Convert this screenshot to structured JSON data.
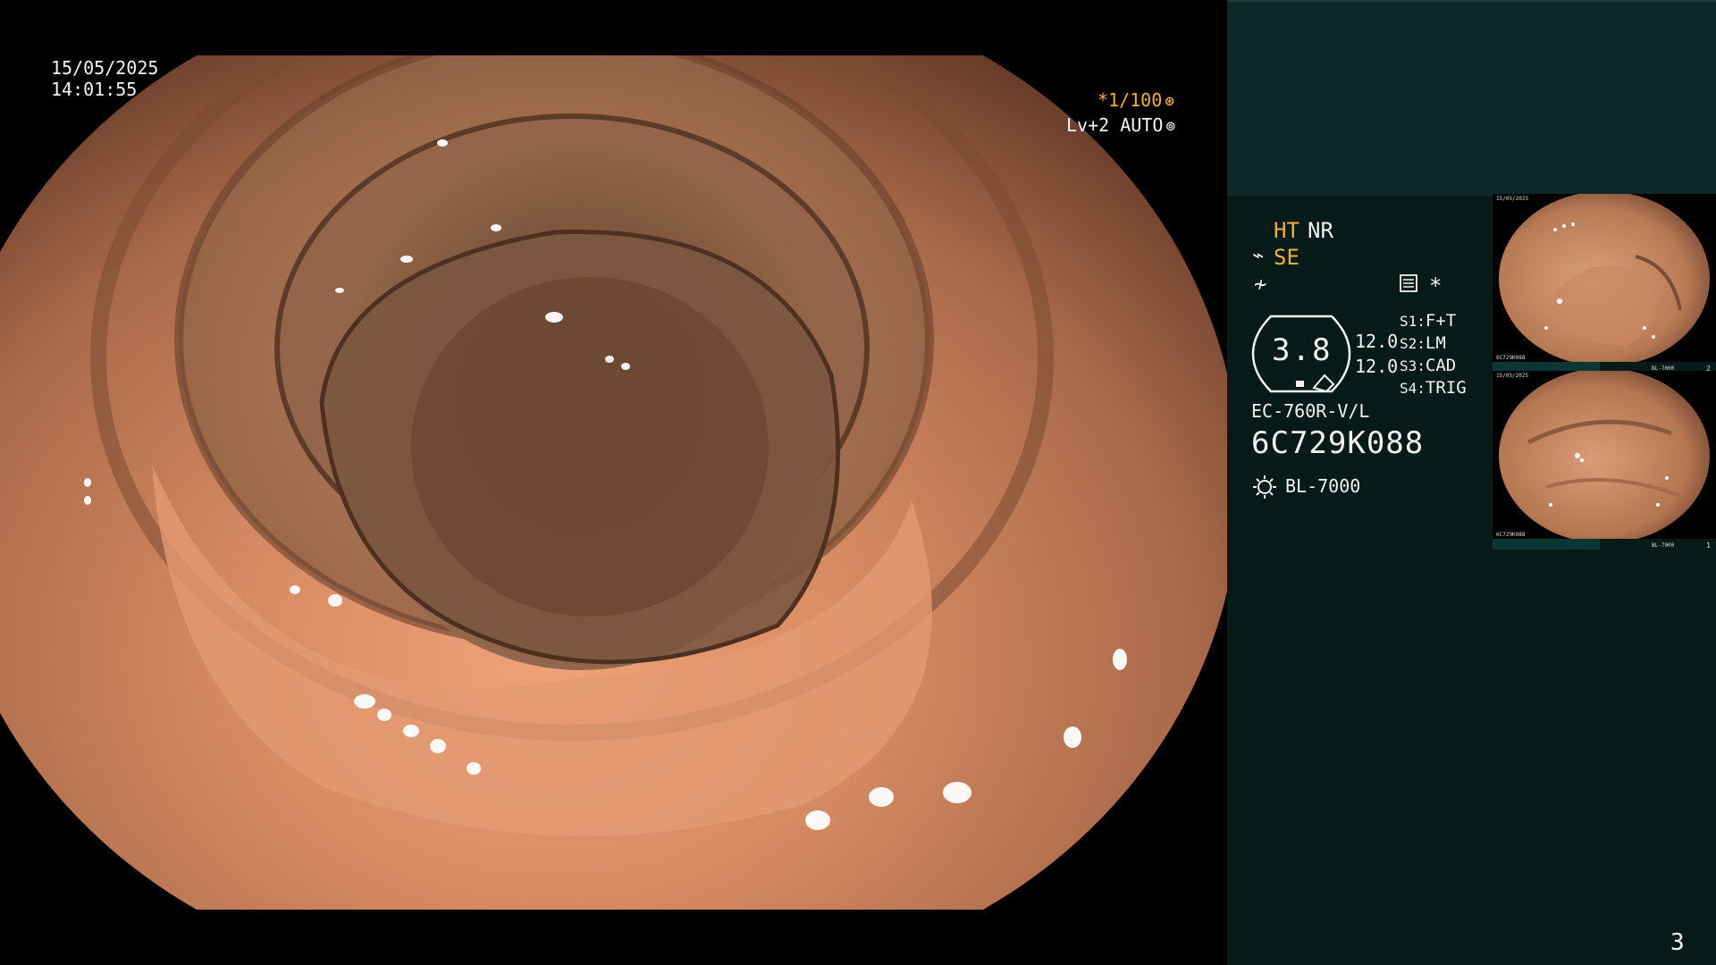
{
  "scope": {
    "date": "15/05/2025",
    "time": "14:01:55",
    "shutter": "*1/100",
    "level": "Lv+2 AUTO"
  },
  "panel": {
    "ht": "HT",
    "nr": "NR",
    "se": "SE",
    "asterisk": "*",
    "zoom": "3.8",
    "value_a": "12.0",
    "value_b": "12.0",
    "switches": [
      {
        "key": "S1:",
        "value": "F+T"
      },
      {
        "key": "S2:",
        "value": "LM"
      },
      {
        "key": "S3:",
        "value": "CAD"
      },
      {
        "key": "S4:",
        "value": "TRIG"
      }
    ],
    "scope_model": "EC-760R-V/L",
    "serial": "6C729K088",
    "lamp": "BL-7000",
    "page": "3"
  },
  "thumbnails": [
    {
      "number": "2",
      "date": "15/05/2025",
      "serial": "6C729K088",
      "lamp": "BL-7000"
    },
    {
      "number": "1",
      "date": "15/05/2025",
      "serial": "6C729K088",
      "lamp": "BL-7000"
    }
  ],
  "colors": {
    "panel_bg": "#061a18",
    "panel_top": "#0f2726",
    "accent_orange": "#f0b13a",
    "tissue": "#c98a5e"
  },
  "icons": [
    "shutter-icon",
    "auto-iris-icon",
    "scope-angle-icon",
    "slash-icon",
    "settings-icon",
    "lamp-icon"
  ]
}
